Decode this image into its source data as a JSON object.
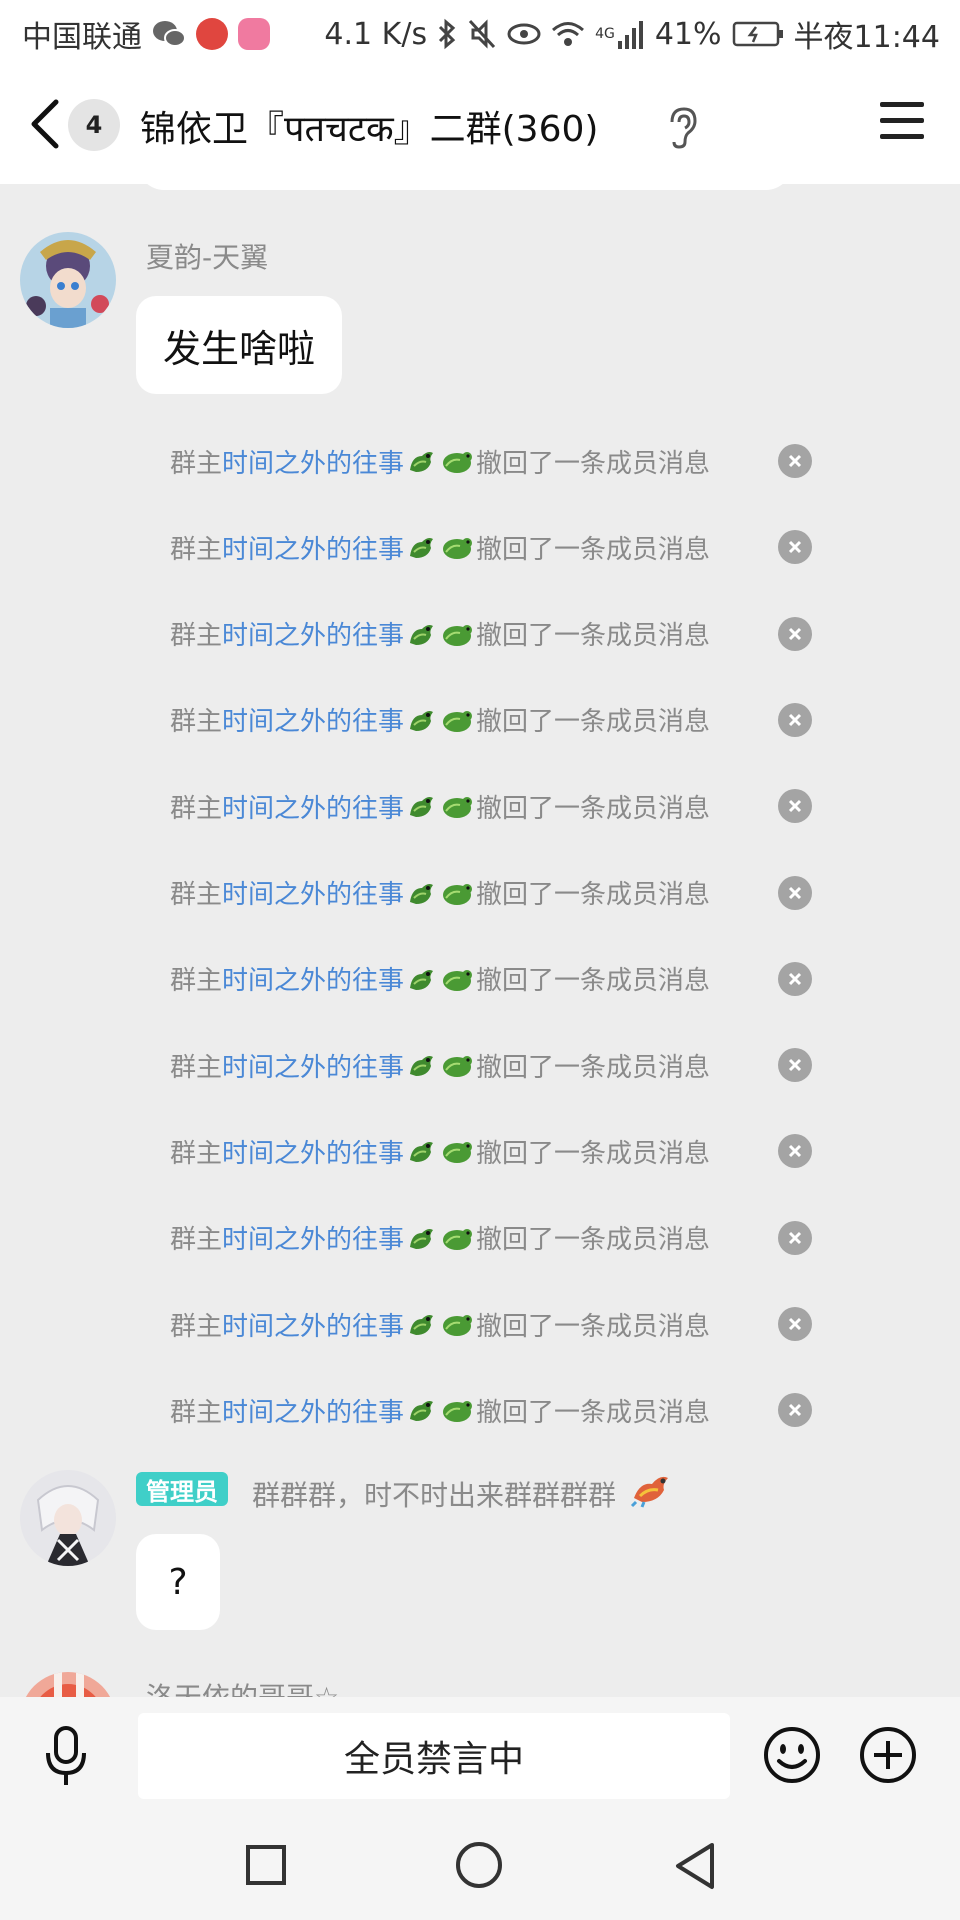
{
  "status_bar": {
    "carrier": "中国联通",
    "speed": "4.1 K/s",
    "network": "4G",
    "battery": "41%",
    "time": "半夜11:44",
    "icons": [
      "wechat-icon",
      "netease-music-icon",
      "bilibili-icon",
      "bluetooth-icon",
      "mute-icon",
      "eye-icon",
      "wifi-icon",
      "signal-icon",
      "battery-icon"
    ]
  },
  "header": {
    "unread_count": "4",
    "title": "锦依卫『पतचटक』二群(360)"
  },
  "messages": {
    "first": {
      "sender": "夏韵-天翼",
      "text": "发生啥啦"
    },
    "recall": {
      "prefix": "群主",
      "name": "时间之外的往事",
      "suffix": "撤回了一条成员消息"
    },
    "second": {
      "role": "管理员",
      "sender": "群群群，时不时出来群群群群",
      "text": "?"
    },
    "third": {
      "sender": "洛天依的哥哥☆"
    }
  },
  "input_bar": {
    "muted_text": "全员禁言中"
  },
  "colors": {
    "background": "#ededed",
    "link_blue": "#4a88d6",
    "admin_tag": "#3fcfc8",
    "system_gray": "#8a8a8a"
  }
}
